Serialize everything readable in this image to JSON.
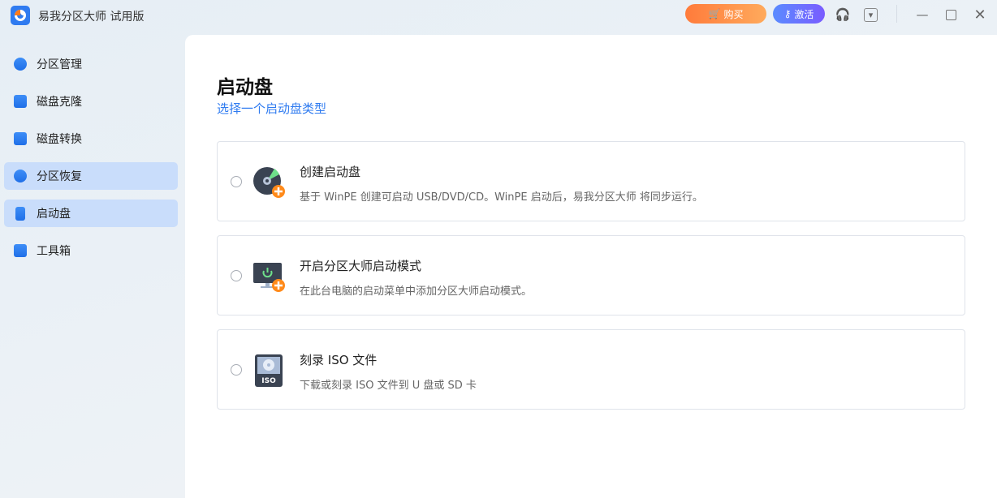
{
  "app": {
    "title": "易我分区大师 试用版",
    "buy_label": "购买",
    "activate_label": "激活"
  },
  "sidebar": {
    "items": [
      {
        "label": "分区管理",
        "icon": "pie-chart-icon",
        "active": false
      },
      {
        "label": "磁盘克隆",
        "icon": "disk-clone-icon",
        "active": false
      },
      {
        "label": "磁盘转换",
        "icon": "disk-convert-icon",
        "active": false
      },
      {
        "label": "分区恢复",
        "icon": "partition-recovery-icon",
        "active": true
      },
      {
        "label": "启动盘",
        "icon": "usb-icon",
        "active": true
      },
      {
        "label": "工具箱",
        "icon": "toolbox-icon",
        "active": false
      }
    ]
  },
  "main": {
    "title": "启动盘",
    "subtitle": "选择一个启动盘类型",
    "options": [
      {
        "title": "创建启动盘",
        "desc": "基于 WinPE 创建可启动 USB/DVD/CD。WinPE 启动后，易我分区大师 将同步运行。",
        "icon": "disc-add-icon"
      },
      {
        "title": "开启分区大师启动模式",
        "desc": "在此台电脑的启动菜单中添加分区大师启动模式。",
        "icon": "monitor-power-icon"
      },
      {
        "title": "刻录 ISO 文件",
        "desc": "下载或刻录 ISO 文件到 U 盘或 SD 卡",
        "icon": "iso-file-icon",
        "badge": "ISO"
      }
    ]
  }
}
